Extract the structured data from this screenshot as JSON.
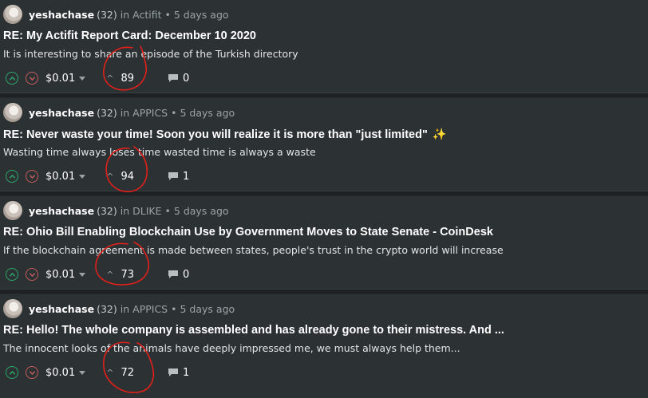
{
  "posts": [
    {
      "author": "yeshachase",
      "reputation": "(32)",
      "in_label": "in",
      "community": "Actifit",
      "time": "5 days ago",
      "title": "RE: My Actifit Report Card: December 10 2020",
      "sparkle": "",
      "excerpt": "It is interesting to share an episode of the Turkish directory",
      "payout": "$0.01",
      "votes": "89",
      "comments": "0"
    },
    {
      "author": "yeshachase",
      "reputation": "(32)",
      "in_label": "in",
      "community": "APPICS",
      "time": "5 days ago",
      "title": "RE: Never waste your time! Soon you will realize it is more than \"just limited\"",
      "sparkle": "✨",
      "excerpt": "Wasting time always loses time wasted time is always a waste",
      "payout": "$0.01",
      "votes": "94",
      "comments": "1"
    },
    {
      "author": "yeshachase",
      "reputation": "(32)",
      "in_label": "in",
      "community": "DLIKE",
      "time": "5 days ago",
      "title": "RE: Ohio Bill Enabling Blockchain Use by Government Moves to State Senate - CoinDesk",
      "sparkle": "",
      "excerpt": "If the blockchain agreement is made between states, people's trust in the crypto world will increase",
      "payout": "$0.01",
      "votes": "73",
      "comments": "0"
    },
    {
      "author": "yeshachase",
      "reputation": "(32)",
      "in_label": "in",
      "community": "APPICS",
      "time": "5 days ago",
      "title": "RE: Hello! The whole company is assembled and has already gone to their mistress. And ...",
      "sparkle": "",
      "excerpt": "The innocent looks of the animals have deeply impressed me, we must always help them...",
      "payout": "$0.01",
      "votes": "72",
      "comments": "1"
    }
  ],
  "colors": {
    "background": "#26292b",
    "card": "#2c3134",
    "upvote": "#2ca86b",
    "downvote": "#c45c5c",
    "annotation": "#e0201a"
  }
}
